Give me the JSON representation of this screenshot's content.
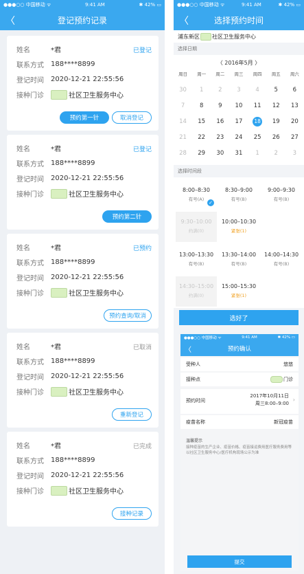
{
  "left": {
    "status": {
      "carrier": "●●●○○ 中国移动 ᯤ",
      "time": "9:41 AM",
      "battery": "✱ 42% ▭"
    },
    "title": "登记预约记录",
    "labels": {
      "name": "姓名",
      "contact": "联系方式",
      "time": "登记时间",
      "clinic": "接种门诊"
    },
    "cards": [
      {
        "name": "*君",
        "phone": "188****8899",
        "time": "2020-12-21 22:55:56",
        "clinic": "社区卫生服务中心",
        "status": "已登记",
        "statusColor": "#2ea3ef",
        "buttons": [
          {
            "label": "预约第一针",
            "style": "fill"
          },
          {
            "label": "取消登记",
            "style": "outline"
          }
        ]
      },
      {
        "name": "*君",
        "phone": "188****8899",
        "time": "2020-12-21 22:55:56",
        "clinic": "社区卫生服务中心",
        "status": "已登记",
        "statusColor": "#2ea3ef",
        "buttons": [
          {
            "label": "预约第二针",
            "style": "fill"
          }
        ]
      },
      {
        "name": "*君",
        "phone": "188****8899",
        "time": "2020-12-21 22:55:56",
        "clinic": "社区卫生服务中心",
        "status": "已预约",
        "statusColor": "#2ea3ef",
        "buttons": [
          {
            "label": "预约查询/取消",
            "style": "outline"
          }
        ]
      },
      {
        "name": "*君",
        "phone": "188****8899",
        "time": "2020-12-21 22:55:56",
        "clinic": "社区卫生服务中心",
        "status": "已取消",
        "statusColor": "#999999",
        "buttons": [
          {
            "label": "重新登记",
            "style": "outline"
          }
        ]
      },
      {
        "name": "*君",
        "phone": "188****8899",
        "time": "2020-12-21 22:55:56",
        "clinic": "社区卫生服务中心",
        "status": "已完成",
        "statusColor": "#999999",
        "buttons": [
          {
            "label": "接种记录",
            "style": "outline"
          }
        ]
      }
    ]
  },
  "right": {
    "status": {
      "carrier": "●●●○○ 中国移动 ᯤ",
      "time": "9:41 AM",
      "battery": "✱ 42% ▭"
    },
    "title": "选择预约时间",
    "location_prefix": "浦东新区",
    "location_suffix": "社区卫生服务中心",
    "date_section": "选择日期",
    "month": "〈  2016年5月  〉",
    "weekdays": [
      "周日",
      "周一",
      "周二",
      "周三",
      "周四",
      "周五",
      "周六"
    ],
    "weeks": [
      [
        "30",
        "1",
        "2",
        "3",
        "4",
        "5",
        "6"
      ],
      [
        "7",
        "8",
        "9",
        "10",
        "11",
        "12",
        "13"
      ],
      [
        "14",
        "15",
        "16",
        "17",
        "18",
        "19",
        "20"
      ],
      [
        "21",
        "22",
        "23",
        "24",
        "25",
        "26",
        "27"
      ],
      [
        "28",
        "29",
        "30",
        "31",
        "1",
        "2",
        "3"
      ]
    ],
    "dim_cells": [
      "0-0",
      "0-1",
      "0-2",
      "0-3",
      "0-4",
      "1-0",
      "2-0",
      "3-0",
      "4-0",
      "4-4",
      "4-5",
      "4-6"
    ],
    "selected_cell": "2-4",
    "time_section": "选择时间段",
    "slots": [
      {
        "time": "8:00–8:30",
        "state": "有号(A)",
        "kind": "normal",
        "checked": true
      },
      {
        "time": "8:30–9:00",
        "state": "有号(B)",
        "kind": "normal"
      },
      {
        "time": "9:00–9:30",
        "state": "有号(B)",
        "kind": "normal"
      },
      {
        "time": "9:30–10:00",
        "state": "约满(0)",
        "kind": "full"
      },
      {
        "time": "10:00–10:30",
        "state": "紧张(1)",
        "kind": "tense"
      },
      {
        "time": "",
        "state": "",
        "kind": "empty"
      },
      {
        "time": "13:00–13:30",
        "state": "有号(B)",
        "kind": "normal"
      },
      {
        "time": "13:30–14:00",
        "state": "有号(B)",
        "kind": "normal"
      },
      {
        "time": "14:00–14:30",
        "state": "有号(B)",
        "kind": "normal"
      },
      {
        "time": "14:30–15:00",
        "state": "约满(0)",
        "kind": "full"
      },
      {
        "time": "15:00–15:30",
        "state": "紧张(1)",
        "kind": "tense"
      },
      {
        "time": "",
        "state": "",
        "kind": "empty"
      }
    ],
    "ok_label": "选好了",
    "confirm": {
      "status": {
        "carrier": "●●●○○ 中国移动 ᯤ",
        "time": "9:41 AM",
        "battery": "✱ 42% ▭"
      },
      "title": "预约确认",
      "person_label": "受种人",
      "person_value": "悠悠",
      "site_label": "接种点",
      "site_value": "门诊",
      "time_label": "预约时间",
      "time_value_1": "2017年10月11日",
      "time_value_2": "周三8:00–9:00",
      "vaccine_label": "疫苗名称",
      "vaccine_value": "新冠疫苗",
      "tip_title": "温馨提示",
      "tip_text": "接种疫苗的生产企业、疫苗价格、疫苗接运费用医疗服务费用等以社区卫生服务中心/医疗机构现场公示为准",
      "submit_label": "提交"
    }
  }
}
